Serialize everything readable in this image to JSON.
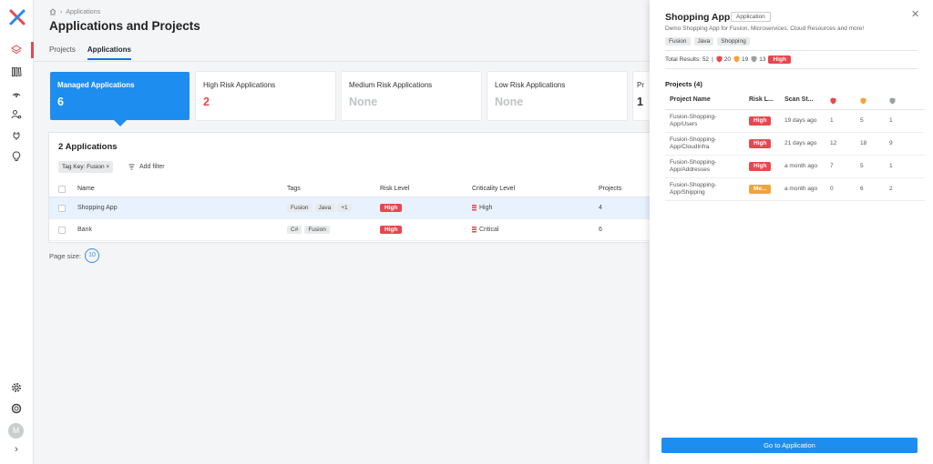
{
  "breadcrumb": {
    "home": "home-icon",
    "current": "Applications"
  },
  "page_title": "Applications and Projects",
  "tabs": [
    {
      "label": "Projects",
      "active": false
    },
    {
      "label": "Applications",
      "active": true
    }
  ],
  "cards": [
    {
      "title": "Managed Applications",
      "value": "6",
      "selected": true
    },
    {
      "title": "High Risk Applications",
      "value": "2"
    },
    {
      "title": "Medium Risk Applications",
      "value": "None"
    },
    {
      "title": "Low Risk Applications",
      "value": "None"
    },
    {
      "title": "Pr",
      "value": "1"
    }
  ],
  "table": {
    "title": "2 Applications",
    "filter_chip": "Tag Key: Fusion ×",
    "add_filter": "Add filter",
    "headers": {
      "name": "Name",
      "tags": "Tags",
      "risk": "Risk Level",
      "criticality": "Criticality Level",
      "projects": "Projects"
    },
    "rows": [
      {
        "name": "Shopping App",
        "tags": [
          "Fusion",
          "Java",
          "+1"
        ],
        "risk": "High",
        "criticality": "High",
        "projects": "4"
      },
      {
        "name": "Bank",
        "tags": [
          "C#",
          "Fusion"
        ],
        "risk": "High",
        "criticality": "Critical",
        "projects": "6"
      }
    ]
  },
  "page_size": {
    "label": "Page size:",
    "value": "10"
  },
  "drawer": {
    "title": "Shopping App",
    "badge": "Application",
    "description": "Demo Shopping App for Fusion, Microservices, Cloud Resources and more!",
    "tags": [
      "Fusion",
      "Java",
      "Shopping"
    ],
    "totals_label": "Total Results: 52",
    "totals": {
      "high": "20",
      "medium": "19",
      "low": "13",
      "risk": "High"
    },
    "projects_title": "Projects (4)",
    "headers": {
      "name": "Project Name",
      "risk": "Risk L...",
      "scan": "Scan St..."
    },
    "projects": [
      {
        "name": "Fusion-Shopping-App/Users",
        "risk": "High",
        "scan": "19 days ago",
        "high": "1",
        "medium": "5",
        "low": "1"
      },
      {
        "name": "Fusion-Shopping-App/CloudInfra",
        "risk": "High",
        "scan": "21 days ago",
        "high": "12",
        "medium": "18",
        "low": "9"
      },
      {
        "name": "Fusion-Shopping-App/Addresses",
        "risk": "High",
        "scan": "a month ago",
        "high": "7",
        "medium": "5",
        "low": "1"
      },
      {
        "name": "Fusion-Shopping-App/Shipping",
        "risk": "Me...",
        "scan": "a month ago",
        "high": "0",
        "medium": "6",
        "low": "2"
      }
    ],
    "go_button": "Go to Application"
  },
  "rail": {
    "avatar": "M"
  },
  "colors": {
    "accent": "#1e8df0",
    "danger": "#e8474f",
    "warning": "#f2a33a"
  }
}
